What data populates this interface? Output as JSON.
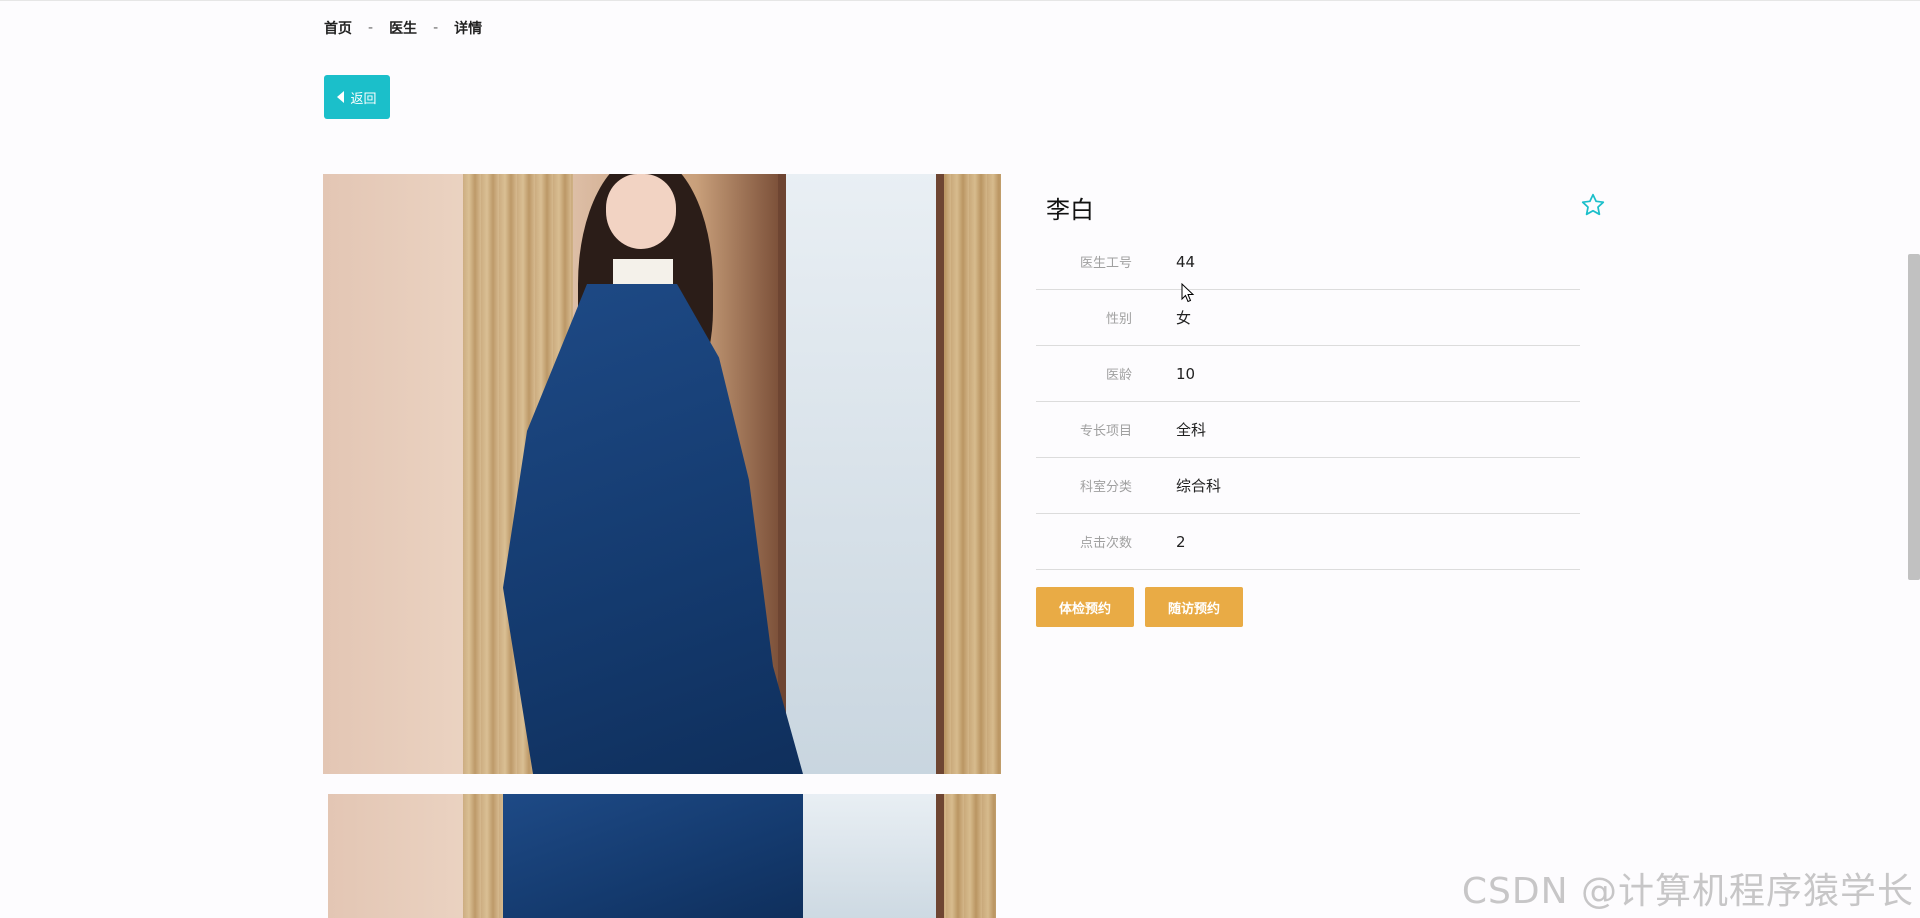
{
  "breadcrumb": {
    "items": [
      "首页",
      "医生",
      "详情"
    ],
    "separator": "-"
  },
  "back_button": {
    "label": "返回",
    "icon": "triangle-left-icon"
  },
  "doctor": {
    "name": "李白",
    "favorite_icon": "star-outline-icon",
    "fields": [
      {
        "label": "医生工号",
        "value": "44"
      },
      {
        "label": "性别",
        "value": "女"
      },
      {
        "label": "医龄",
        "value": "10"
      },
      {
        "label": "专长项目",
        "value": "全科"
      },
      {
        "label": "科室分类",
        "value": "综合科"
      },
      {
        "label": "点击次数",
        "value": "2"
      }
    ]
  },
  "actions": {
    "exam_booking": "体检预约",
    "followup_booking": "随访预约"
  },
  "watermark": "CSDN @计算机程序猿学长",
  "colors": {
    "accent": "#1bbfca",
    "action": "#e9ab45",
    "background": "#fdfcfe"
  }
}
